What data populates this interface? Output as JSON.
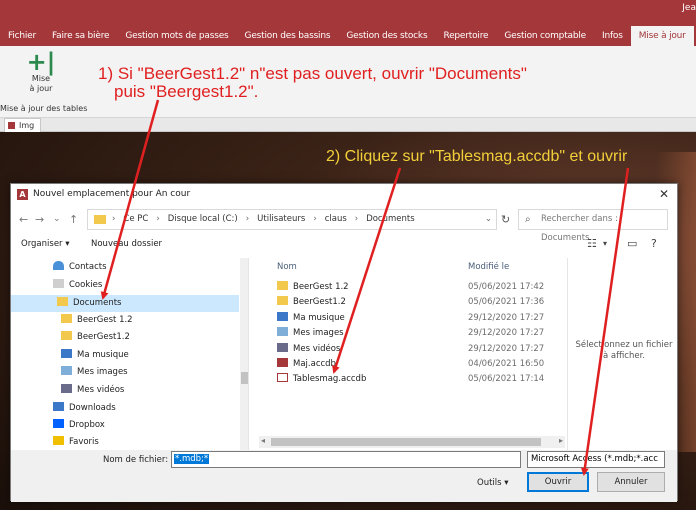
{
  "app": {
    "user": "Jea",
    "tabs": [
      {
        "label": "Fichier"
      },
      {
        "label": "Faire sa bière"
      },
      {
        "label": "Gestion mots de passes"
      },
      {
        "label": "Gestion des bassins"
      },
      {
        "label": "Gestion des stocks"
      },
      {
        "label": "Repertoire"
      },
      {
        "label": "Gestion comptable"
      },
      {
        "label": "Infos"
      },
      {
        "label": "Mise à jour"
      }
    ],
    "ribbon": {
      "button_label_1": "Mise",
      "button_label_2": "à jour",
      "group_label": "Mise à jour des tables"
    },
    "doc_tab": "Img"
  },
  "annotations": {
    "step1_line1": "1) Si \"BeerGest1.2\" n\"est pas ouvert, ouvrir \"Documents\"",
    "step1_line2": "puis \"Beergest1.2\".",
    "step2": "2) Cliquez sur \"Tablesmag.accdb\" et ouvrir"
  },
  "dialog": {
    "title": "Nouvel emplacement pour An cour",
    "close": "✕",
    "breadcrumb": [
      "Ce PC",
      "Disque local (C:)",
      "Utilisateurs",
      "claus",
      "Documents"
    ],
    "search_placeholder": "Rechercher dans : Documents",
    "toolbar": {
      "organize": "Organiser ▾",
      "new_folder": "Nouveau dossier"
    },
    "nav_items": [
      {
        "label": "Contacts",
        "icon": "contact"
      },
      {
        "label": "Cookies",
        "icon": "cookie"
      },
      {
        "label": "Documents",
        "icon": "folder"
      },
      {
        "label": "BeerGest 1.2",
        "icon": "folder"
      },
      {
        "label": "BeerGest1.2",
        "icon": "folder"
      },
      {
        "label": "Ma musique",
        "icon": "music"
      },
      {
        "label": "Mes images",
        "icon": "images"
      },
      {
        "label": "Mes vidéos",
        "icon": "videos"
      },
      {
        "label": "Downloads",
        "icon": "download"
      },
      {
        "label": "Dropbox",
        "icon": "dropbox"
      },
      {
        "label": "Favoris",
        "icon": "fav"
      }
    ],
    "columns": {
      "name": "Nom",
      "modified": "Modifié le"
    },
    "files": [
      {
        "name": "BeerGest 1.2",
        "date": "05/06/2021 17:42",
        "icon": "folder"
      },
      {
        "name": "BeerGest1.2",
        "date": "05/06/2021 17:36",
        "icon": "folder"
      },
      {
        "name": "Ma musique",
        "date": "29/12/2020 17:27",
        "icon": "music"
      },
      {
        "name": "Mes images",
        "date": "29/12/2020 17:27",
        "icon": "images"
      },
      {
        "name": "Mes vidéos",
        "date": "29/12/2020 17:27",
        "icon": "videos"
      },
      {
        "name": "Maj.accdb",
        "date": "04/06/2021 16:50",
        "icon": "accdb"
      },
      {
        "name": "Tablesmag.accdb",
        "date": "05/06/2021 17:14",
        "icon": "accdb2"
      }
    ],
    "preview_text": "Sélectionnez un fichier à afficher.",
    "filename_label": "Nom de fichier:",
    "filename_value": "*.mdb;*",
    "filetype_value": "Microsoft Access (*.mdb;*.acc",
    "tools": "Outils ▾",
    "open": "Ouvrir",
    "cancel": "Annuler"
  },
  "colors": {
    "accent": "#a4373a",
    "annotation_red": "#e02020",
    "annotation_yellow": "#f2cf3a",
    "selection": "#cce8ff"
  }
}
